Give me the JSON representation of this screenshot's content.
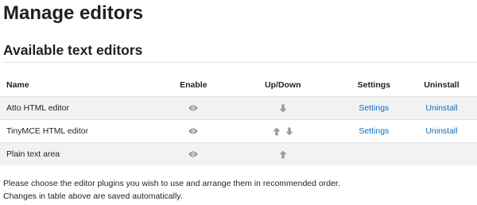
{
  "page": {
    "title": "Manage editors",
    "section_title": "Available text editors"
  },
  "table": {
    "headers": {
      "name": "Name",
      "enable": "Enable",
      "updown": "Up/Down",
      "settings": "Settings",
      "uninstall": "Uninstall"
    },
    "rows": [
      {
        "name": "Atto HTML editor",
        "enabled": true,
        "up": false,
        "down": true,
        "settings": "Settings",
        "uninstall": "Uninstall"
      },
      {
        "name": "TinyMCE HTML editor",
        "enabled": true,
        "up": true,
        "down": true,
        "settings": "Settings",
        "uninstall": "Uninstall"
      },
      {
        "name": "Plain text area",
        "enabled": true,
        "up": true,
        "down": false,
        "settings": "",
        "uninstall": ""
      }
    ]
  },
  "notes": {
    "line1": "Please choose the editor plugins you wish to use and arrange them in recommended order.",
    "line2": "Changes in table above are saved automatically."
  },
  "icons": {
    "enable": "eye-icon",
    "up": "arrow-up-icon",
    "down": "arrow-down-icon"
  },
  "colors": {
    "link": "#0f6cbf",
    "icon": "#999999",
    "stripe": "#f2f2f2",
    "border": "#dee2e6"
  }
}
